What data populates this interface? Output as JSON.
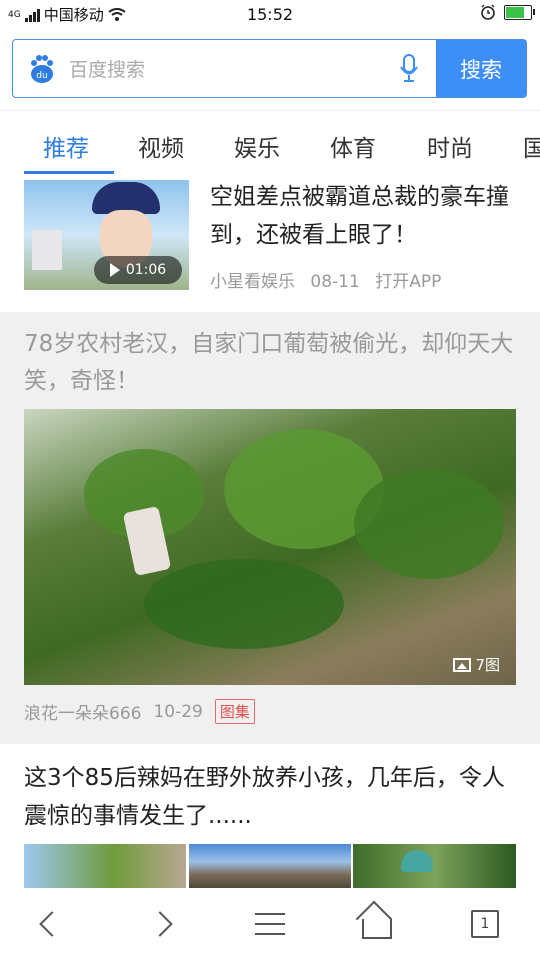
{
  "status_bar": {
    "signal_label": "4G",
    "carrier": "中国移动",
    "time": "15:52"
  },
  "search": {
    "placeholder": "百度搜索",
    "button_label": "搜索",
    "logo_text": "du"
  },
  "tabs": [
    {
      "label": "推荐",
      "active": true
    },
    {
      "label": "视频",
      "active": false
    },
    {
      "label": "娱乐",
      "active": false
    },
    {
      "label": "体育",
      "active": false
    },
    {
      "label": "时尚",
      "active": false
    },
    {
      "label": "国",
      "active": false
    }
  ],
  "feed": {
    "item1": {
      "title": "空姐差点被霸道总裁的豪车撞到，还被看上眼了！",
      "duration": "01:06",
      "source": "小星看娱乐",
      "date": "08-11",
      "action": "打开APP"
    },
    "item2": {
      "title": "78岁农村老汉，自家门口葡萄被偷光，却仰天大笑，奇怪！",
      "photo_count": "7图",
      "source": "浪花一朵朵666",
      "date": "10-29",
      "badge": "图集"
    },
    "item3": {
      "title": "这3个85后辣妈在野外放养小孩，几年后，令人震惊的事情发生了......"
    }
  },
  "bottom_bar": {
    "tab_count": "1"
  },
  "colors": {
    "accent": "#2f7de1",
    "search_button": "#3e8ef7",
    "badge": "#e04f4f"
  }
}
